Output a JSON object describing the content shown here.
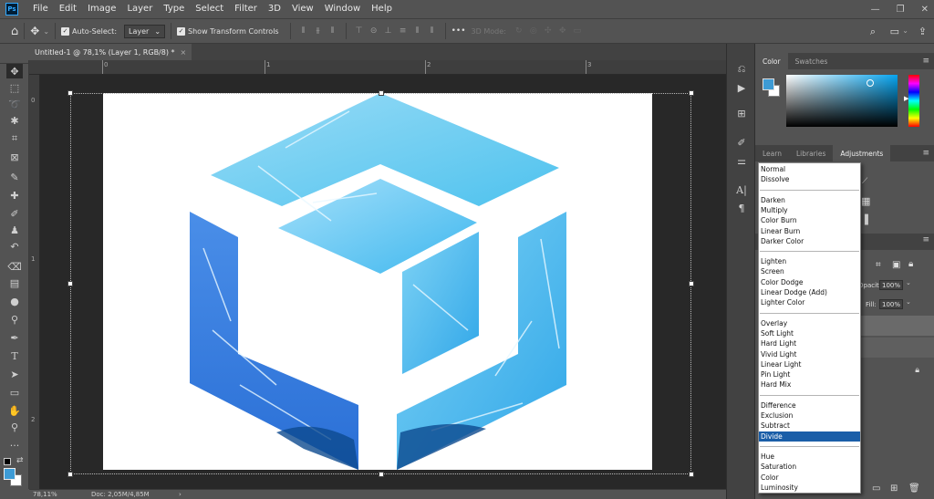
{
  "app": {
    "logo": "Ps",
    "window_controls": [
      "—",
      "❐",
      "✕"
    ]
  },
  "menu": [
    "File",
    "Edit",
    "Image",
    "Layer",
    "Type",
    "Select",
    "Filter",
    "3D",
    "View",
    "Window",
    "Help"
  ],
  "options_bar": {
    "auto_select_label": "Auto-Select:",
    "auto_select_value": "Layer",
    "show_transform_label": "Show Transform Controls",
    "mode_3d_label": "3D Mode:",
    "more": "•••"
  },
  "document": {
    "tab_title": "Untitled-1 @ 78,1% (Layer 1, RGB/8) *",
    "tab_close": "×",
    "ruler_top": [
      "0",
      "1",
      "2",
      "3"
    ],
    "ruler_left": [
      "0",
      "1",
      "2"
    ]
  },
  "status_bar": {
    "zoom": "78,11%",
    "doc_info": "Doc: 2,05M/4,85M",
    "arrow": "›"
  },
  "panels": {
    "color_tabs": [
      "Color",
      "Swatches"
    ],
    "adjust_tabs": [
      "Learn",
      "Libraries",
      "Adjustments"
    ],
    "foreground_color": "#3d9bd5",
    "background_color": "#ffffff",
    "opacity_label": "Opacity:",
    "opacity_value": "100%",
    "fill_label": "Fill:",
    "fill_value": "100%"
  },
  "blend_modes": {
    "groups": [
      [
        "Normal",
        "Dissolve"
      ],
      [
        "Darken",
        "Multiply",
        "Color Burn",
        "Linear Burn",
        "Darker Color"
      ],
      [
        "Lighten",
        "Screen",
        "Color Dodge",
        "Linear Dodge (Add)",
        "Lighter Color"
      ],
      [
        "Overlay",
        "Soft Light",
        "Hard Light",
        "Vivid Light",
        "Linear Light",
        "Pin Light",
        "Hard Mix"
      ],
      [
        "Difference",
        "Exclusion",
        "Subtract",
        "Divide"
      ],
      [
        "Hue",
        "Saturation",
        "Color",
        "Luminosity"
      ]
    ],
    "selected": "Divide"
  },
  "artwork": {
    "colors": [
      "#4ec2ee",
      "#2a6fd6",
      "#9adcf6"
    ]
  }
}
